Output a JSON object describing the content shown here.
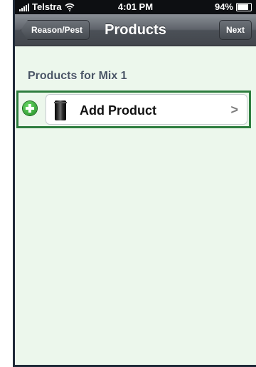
{
  "status_bar": {
    "carrier": "Telstra",
    "time": "4:01 PM",
    "battery": "94%",
    "battery_level": 0.94
  },
  "nav_bar": {
    "back_label": "Reason/Pest",
    "title": "Products",
    "next_label": "Next"
  },
  "section": {
    "header": "Products for Mix 1"
  },
  "rows": [
    {
      "label": "Add Product",
      "icon": "barrel-icon",
      "accessory": "chevron-right-icon"
    }
  ],
  "colors": {
    "background": "#ecf7ec",
    "highlight_border": "#2e7d3f",
    "add_button": "#2fa82f"
  }
}
